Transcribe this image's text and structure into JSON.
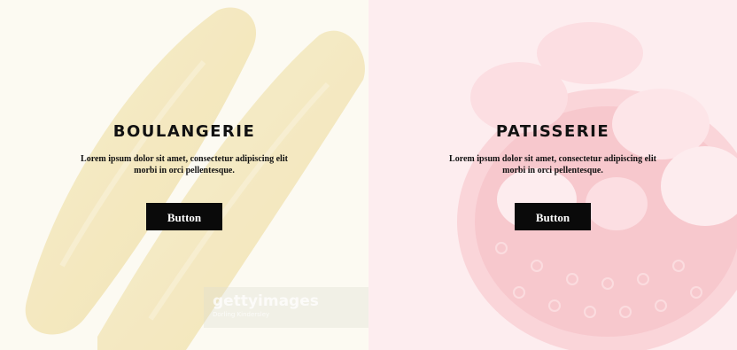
{
  "panels": [
    {
      "title": "BOULANGERIE",
      "description": "Lorem ipsum dolor sit amet, consectetur adipiscing elit morbi in orci pellentesque.",
      "button_label": "Button",
      "photo_icon": "baguette-image"
    },
    {
      "title": "PATISSERIE",
      "description": "Lorem ipsum dolor sit amet, consectetur adipiscing elit morbi in orci pellentesque.",
      "button_label": "Button",
      "photo_icon": "macarons-image"
    }
  ],
  "watermark": {
    "logo": "gettyimages",
    "credit": "Dorling Kindersley"
  },
  "colors": {
    "left_bg": "#faf6e8",
    "right_bg": "#fbe3e6",
    "button_bg": "#0a0a0a",
    "button_text": "#ffffff"
  }
}
